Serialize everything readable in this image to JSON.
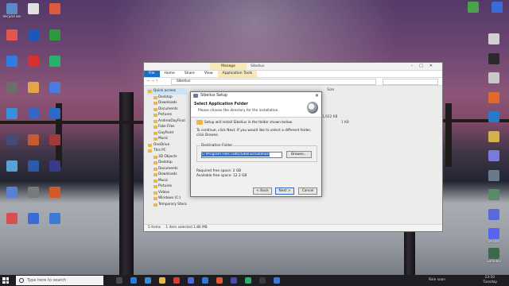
{
  "desktop": {
    "left_icons": [
      {
        "label": "Recycle Bin",
        "color": "#5b8bc7"
      },
      {
        "label": "",
        "color": "#e2574c"
      },
      {
        "label": "",
        "color": "#2e7de0"
      },
      {
        "label": "",
        "color": "#6d6d6d"
      },
      {
        "label": "",
        "color": "#3a8fdc"
      },
      {
        "label": "",
        "color": "#444a7a"
      },
      {
        "label": "",
        "color": "#5aa0d8"
      },
      {
        "label": "",
        "color": "#5a7fd4"
      },
      {
        "label": "",
        "color": "#d84f4f"
      },
      {
        "label": "",
        "color": "#e0e0e0"
      },
      {
        "label": "",
        "color": "#1d58b8"
      },
      {
        "label": "",
        "color": "#d6312c"
      },
      {
        "label": "",
        "color": "#e2a54a"
      },
      {
        "label": "",
        "color": "#3a64c4"
      },
      {
        "label": "",
        "color": "#c95a30"
      },
      {
        "label": "",
        "color": "#2d5aa8"
      },
      {
        "label": "",
        "color": "#7a7a7a"
      },
      {
        "label": "",
        "color": "#3a6bd6"
      },
      {
        "label": "",
        "color": "#e05a3a"
      },
      {
        "label": "",
        "color": "#2a9a3a"
      },
      {
        "label": "",
        "color": "#27b16b"
      },
      {
        "label": "",
        "color": "#4a7be0"
      },
      {
        "label": "",
        "color": "#2b6ac7"
      },
      {
        "label": "",
        "color": "#a23a3a"
      },
      {
        "label": "",
        "color": "#3a3a8a"
      },
      {
        "label": "",
        "color": "#d25a2a"
      },
      {
        "label": "",
        "color": "#3a7bd6"
      }
    ],
    "right_icons": [
      {
        "label": "",
        "color": "#4aa34a"
      },
      {
        "label": "",
        "color": "#3a6bd6"
      },
      {
        "label": "",
        "color": "#d0d0d0"
      },
      {
        "label": "",
        "color": "#2a2a2a"
      },
      {
        "label": "",
        "color": "#c8c8c8"
      },
      {
        "label": "",
        "color": "#e06a2a"
      },
      {
        "label": "",
        "color": "#2a7acc"
      },
      {
        "label": "",
        "color": "#d6b04a"
      },
      {
        "label": "",
        "color": "#7a7adc"
      },
      {
        "label": "",
        "color": "#6a7a8a"
      },
      {
        "label": "",
        "color": "#5a8a6a"
      },
      {
        "label": "",
        "color": "#5a6ad6"
      },
      {
        "label": "Discord",
        "color": "#5865f2"
      },
      {
        "label": "Gamebar",
        "color": "#3a6a4a"
      }
    ]
  },
  "explorer": {
    "title": "Sibelius",
    "manage_tab": "Manage",
    "ribbon": [
      "File",
      "Home",
      "Share",
      "View",
      "Application Tools"
    ],
    "address": "Sibelius",
    "nav": [
      {
        "label": "Quick access",
        "sub": false,
        "selected": true
      },
      {
        "label": "Desktop",
        "sub": true
      },
      {
        "label": "Downloads",
        "sub": true
      },
      {
        "label": "Documents",
        "sub": true
      },
      {
        "label": "Pictures",
        "sub": true
      },
      {
        "label": "AndreaDayFinal",
        "sub": true
      },
      {
        "label": "Fake Files",
        "sub": true
      },
      {
        "label": "GayPoint",
        "sub": true
      },
      {
        "label": "Music",
        "sub": true
      },
      {
        "label": "OneDrive",
        "sub": false
      },
      {
        "label": "This PC",
        "sub": false
      },
      {
        "label": "3D Objects",
        "sub": true
      },
      {
        "label": "Desktop",
        "sub": true
      },
      {
        "label": "Documents",
        "sub": true
      },
      {
        "label": "Downloads",
        "sub": true
      },
      {
        "label": "Music",
        "sub": true
      },
      {
        "label": "Pictures",
        "sub": true
      },
      {
        "label": "Videos",
        "sub": true
      },
      {
        "label": "Windows (C:)",
        "sub": true
      },
      {
        "label": "Temporary Stora",
        "sub": true
      }
    ],
    "col_size": "Size",
    "size_values": [
      "1,922 KB",
      "1 KB"
    ],
    "status_items": "5 items",
    "status_selected": "1 item selected  1.86 MB"
  },
  "dialog": {
    "title": "Sibelius Setup",
    "heading": "Select Application Folder",
    "subheading": "Please choose the directory for the installation.",
    "line1": "Setup will install Sibelius in the folder shown below.",
    "line2": "To continue, click Next. If you would like to select a different folder, click Browse.",
    "group_label": "Destination Folder",
    "path": "C:\\Program Files (x86)\\Sibelius\\Sibelius\\",
    "browse": "Browse...",
    "required_space": "Required free space: 2 GB",
    "available_space": "Available free space: 12.3 GB",
    "back": "< Back",
    "next": "Next >",
    "cancel": "Cancel"
  },
  "taskbar": {
    "search_placeholder": "Type here to search",
    "apps": [
      "#4a4a4a",
      "#2a7ae0",
      "#3a8ad6",
      "#e8b94a",
      "#d63a3a",
      "#4a6ad6",
      "#2a7ae0",
      "#e05a2a",
      "#4a4aa8",
      "#2ab06a",
      "#3a3a3a",
      "#3a7ad6"
    ],
    "weather": "Rain soon",
    "time": "23:10",
    "date": "Tuesday"
  }
}
